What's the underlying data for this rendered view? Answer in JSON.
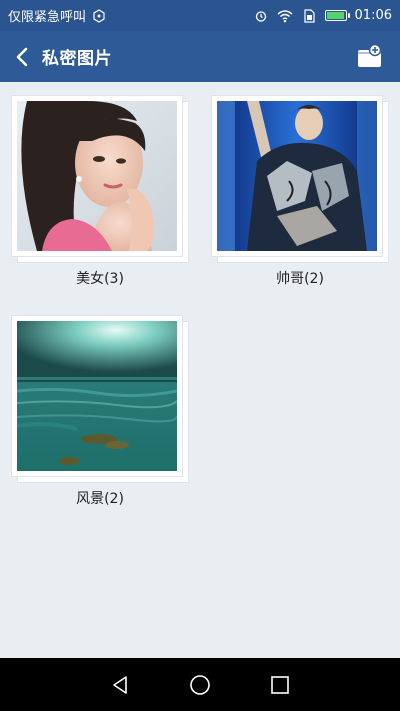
{
  "status_bar": {
    "carrier_text": "仅限紧急呼叫",
    "time": "01:06",
    "battery_level": 0.9
  },
  "app_bar": {
    "title": "私密图片",
    "back_icon": "back-arrow-icon",
    "action_icon": "add-album-icon"
  },
  "albums": [
    {
      "label": "美女(3)",
      "thumbnail": "portrait of a woman"
    },
    {
      "label": "帅哥(2)",
      "thumbnail": "man on stage"
    },
    {
      "label": "风景(2)",
      "thumbnail": "sea landscape"
    }
  ],
  "nav_bar": {
    "back": "triangle-back-icon",
    "home": "circle-home-icon",
    "recents": "square-recents-icon"
  },
  "colors": {
    "status_bar": "#2b5591",
    "app_bar": "#2e5a98",
    "background": "#e9eef2"
  }
}
